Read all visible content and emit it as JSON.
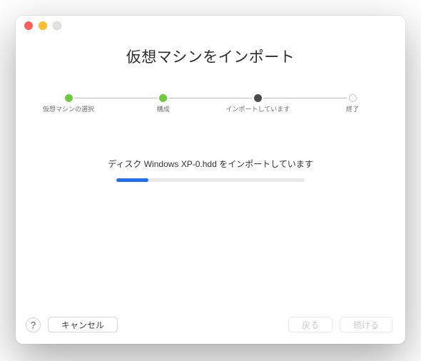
{
  "header": {
    "title": "仮想マシンをインポート"
  },
  "stepper": {
    "steps": [
      {
        "label": "仮想マシンの選択",
        "state": "done"
      },
      {
        "label": "構成",
        "state": "done"
      },
      {
        "label": "インポートしています",
        "state": "current"
      },
      {
        "label": "終了",
        "state": "pending"
      }
    ]
  },
  "progress": {
    "label": "ディスク Windows XP-0.hdd をインポートしています",
    "percent": 17
  },
  "footer": {
    "help_label": "?",
    "cancel_label": "キャンセル",
    "back_label": "戻る",
    "continue_label": "続ける",
    "back_enabled": false,
    "continue_enabled": false
  }
}
